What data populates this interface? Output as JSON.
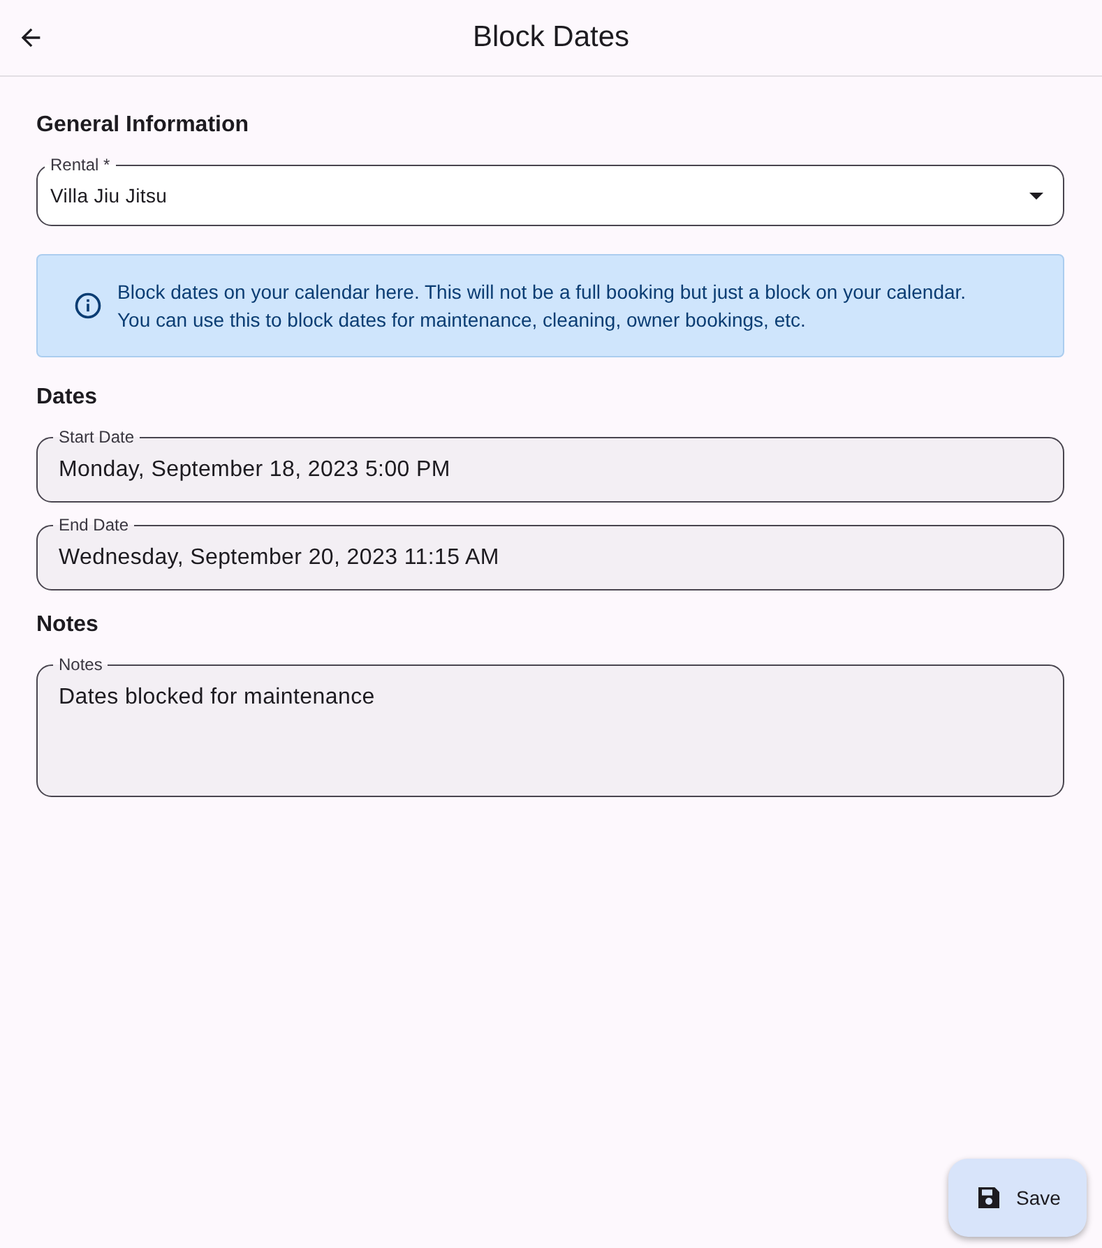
{
  "app_bar": {
    "title": "Block Dates"
  },
  "general": {
    "heading": "General Information",
    "rental": {
      "label": "Rental *",
      "value": "Villa Jiu Jitsu"
    },
    "info": "Block dates on your calendar here. This will not be a full booking but just a block on your calendar. You can use this to block dates for maintenance, cleaning, owner bookings, etc."
  },
  "dates": {
    "heading": "Dates",
    "fields": [
      {
        "label": "Start Date",
        "value": "Monday, September 18, 2023 5:00 PM"
      },
      {
        "label": "End Date",
        "value": "Wednesday, September 20, 2023 11:15 AM"
      }
    ]
  },
  "notes": {
    "heading": "Notes",
    "field": {
      "label": "Notes",
      "value": "Dates blocked for maintenance"
    }
  },
  "fab": {
    "label": "Save"
  }
}
